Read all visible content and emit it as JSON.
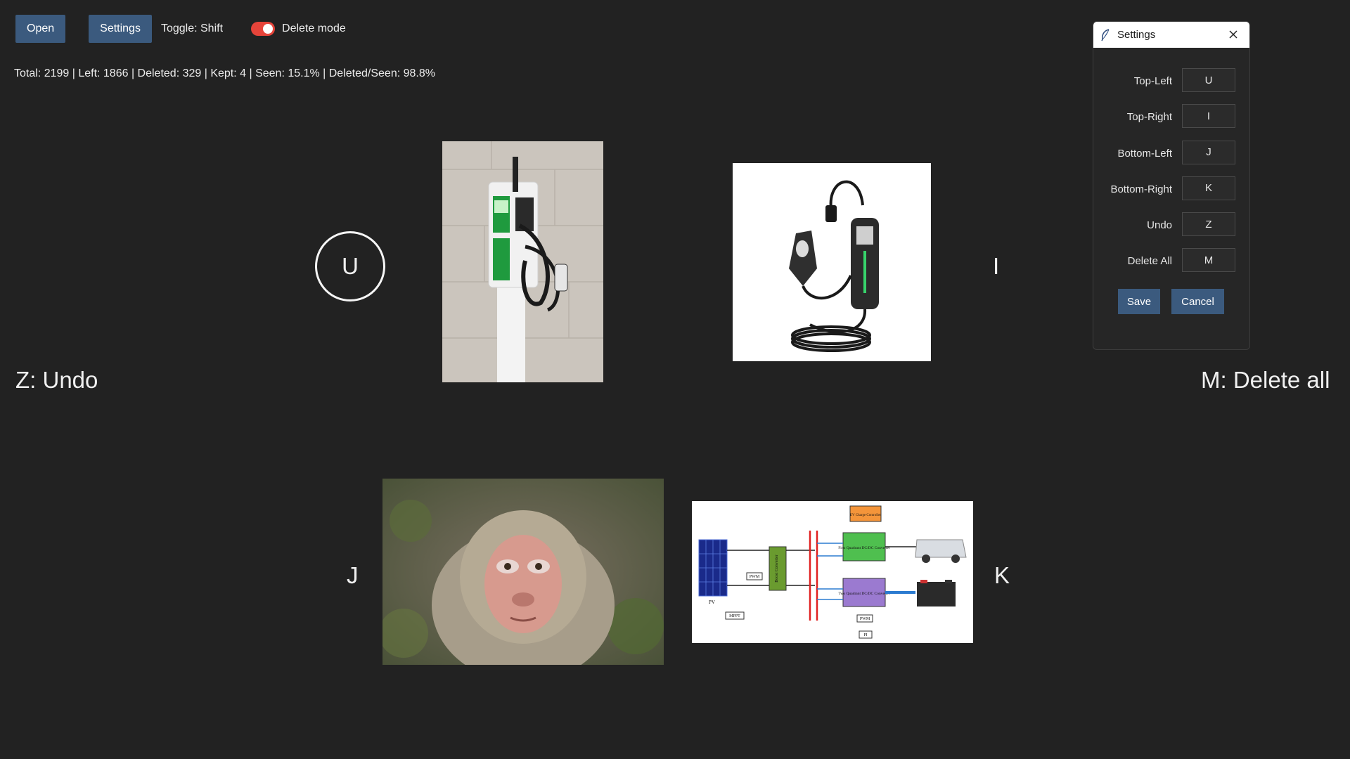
{
  "toolbar": {
    "open_label": "Open",
    "settings_label": "Settings",
    "toggle_hint": "Toggle: Shift",
    "delete_mode_label": "Delete mode",
    "delete_mode_on": true
  },
  "stats": "Total: 2199 | Left: 1866 | Deleted: 329 | Kept: 4 | Seen: 15.1% | Deleted/Seen: 98.8%",
  "quadrants": {
    "top_left_key": "U",
    "top_right_key": "I",
    "bottom_left_key": "J",
    "bottom_right_key": "K"
  },
  "hints": {
    "undo": "Z: Undo",
    "delete_all": "M: Delete all"
  },
  "images": {
    "top_left": "wall-mounted EV charging station",
    "top_right": "portable EV charger with cable",
    "bottom_left": "macaque monkey face",
    "bottom_right": "solar PV EV charging system diagram"
  },
  "diagram": {
    "pv": "PV",
    "mppt": "MPPT",
    "pwm": "PWM",
    "boost": "Boost Converter",
    "ev_controller": "EV Charge Controller",
    "first_quadrant": "First Quadrant DC/DC Converter",
    "two_quadrant": "Two Quadrant DC/DC Converter",
    "pi": "PI"
  },
  "settings_dialog": {
    "title": "Settings",
    "rows": [
      {
        "label": "Top-Left",
        "value": "U"
      },
      {
        "label": "Top-Right",
        "value": "I"
      },
      {
        "label": "Bottom-Left",
        "value": "J"
      },
      {
        "label": "Bottom-Right",
        "value": "K"
      },
      {
        "label": "Undo",
        "value": "Z"
      },
      {
        "label": "Delete All",
        "value": "M"
      }
    ],
    "save_label": "Save",
    "cancel_label": "Cancel"
  },
  "colors": {
    "background": "#222222",
    "button": "#3b5a7e",
    "toggle_on": "#e6443a"
  }
}
